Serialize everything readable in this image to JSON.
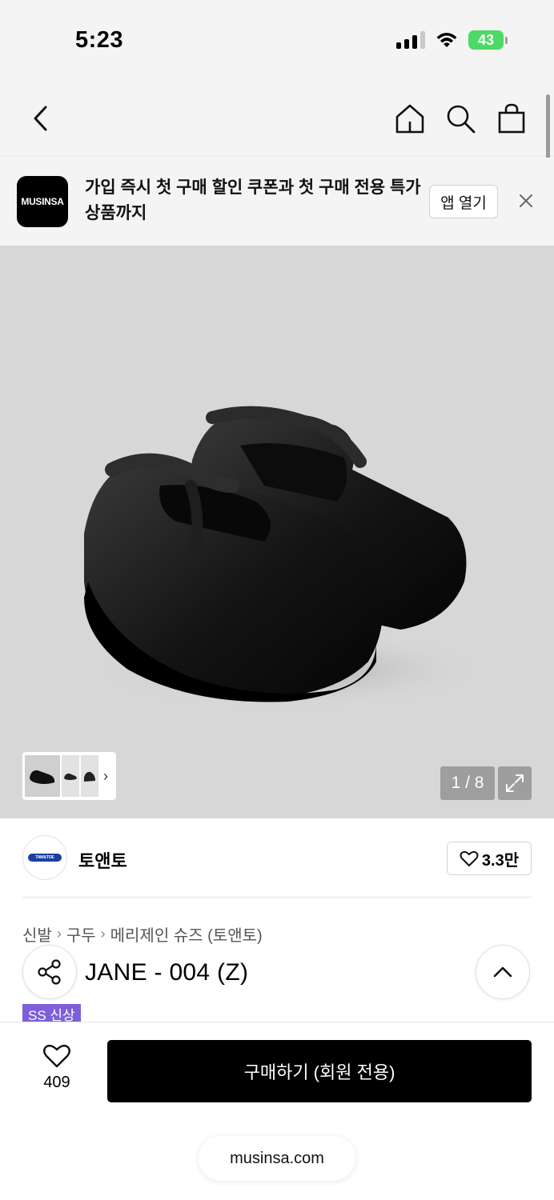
{
  "status_bar": {
    "time": "5:23",
    "battery": "43"
  },
  "header": {
    "back_icon": "chevron-left-icon",
    "home_icon": "home-icon",
    "search_icon": "search-icon",
    "cart_icon": "shopping-bag-icon"
  },
  "banner": {
    "logo_text": "MUSINSA",
    "message": "가입 즉시 첫 구매 할인 쿠폰과 첫 구매 전용 특가 상품까지",
    "open_app_label": "앱 열기",
    "close_icon": "close-icon"
  },
  "gallery": {
    "counter": "1 / 8",
    "expand_icon": "expand-icon",
    "next_icon": "chevron-right-icon"
  },
  "brand": {
    "logo_text": "TAW&TOE",
    "name": "토앤토",
    "likes": "3.3만"
  },
  "breadcrumb": [
    "신발",
    "구두",
    "메리제인 슈즈 (토앤토)"
  ],
  "product": {
    "title_visible": "JANE - 004 (Z)",
    "badge": "SS 신상"
  },
  "bottom_bar": {
    "like_count": "409",
    "buy_label": "구매하기 (회원 전용)",
    "url": "musinsa.com"
  },
  "colors": {
    "background": "#f4f4f4",
    "image_bg": "#d7d7d7",
    "badge": "#7e5fd9",
    "button": "#000000",
    "battery": "#4cd964"
  }
}
